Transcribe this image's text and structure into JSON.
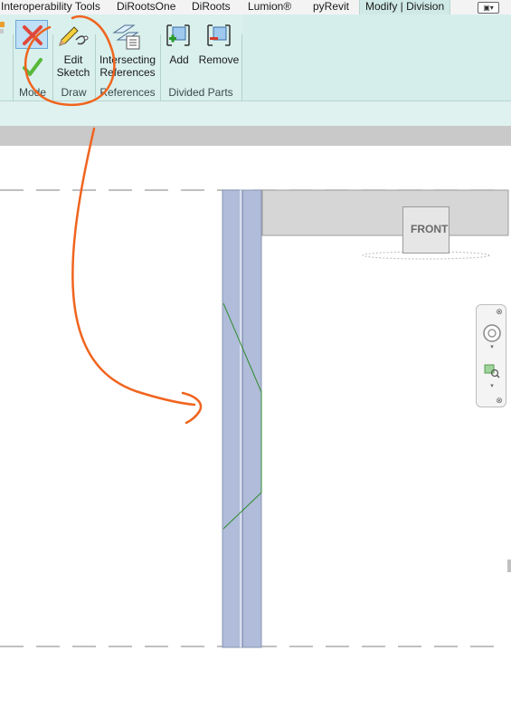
{
  "tabs": [
    {
      "label": "Interoperability Tools",
      "active": false
    },
    {
      "label": "DiRootsOne",
      "active": false
    },
    {
      "label": "DiRoots",
      "active": false
    },
    {
      "label": "Lumion®",
      "active": false
    },
    {
      "label": "pyRevit",
      "active": false
    },
    {
      "label": "Modify | Division",
      "active": true
    }
  ],
  "ribbon": {
    "panels": [
      {
        "label": "Mode"
      },
      {
        "label": "Draw"
      },
      {
        "label": "References"
      },
      {
        "label": "Divided Parts"
      }
    ],
    "buttons": {
      "edit_sketch": {
        "line1": "Edit",
        "line2": "Sketch"
      },
      "intersecting_references": {
        "line1": "Intersecting",
        "line2": "References"
      },
      "add": {
        "label": "Add"
      },
      "remove": {
        "label": "Remove"
      }
    }
  },
  "viewcube": {
    "face_label": "FRONT"
  },
  "colors": {
    "ribbon_bg": "#d6eeeb",
    "active_tab_bg": "#cfeae6",
    "wall_fill": "#b0bcd9",
    "sketch_line": "#2e8b2e",
    "annotation_orange": "#f0641e",
    "cancel_red": "#e0483a",
    "finish_green": "#58b83a"
  }
}
